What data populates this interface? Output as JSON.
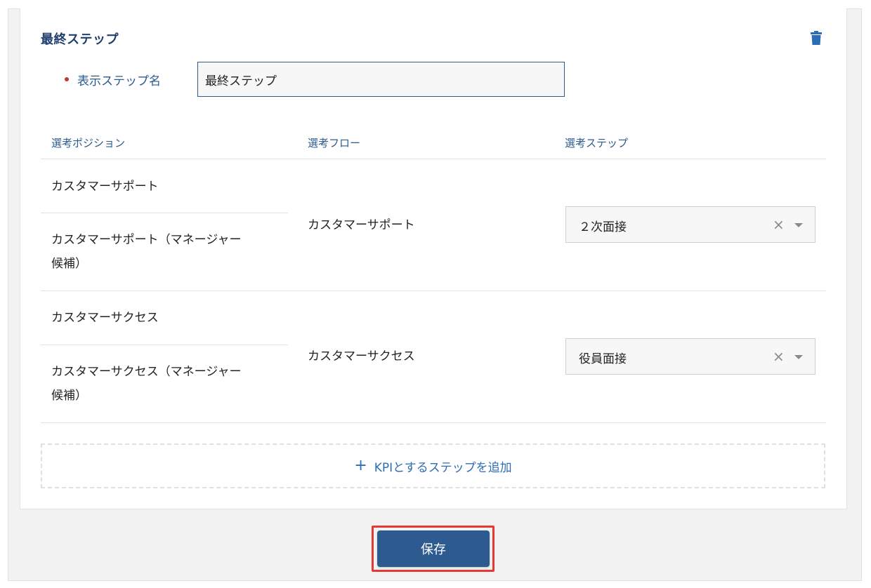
{
  "step": {
    "title": "最終ステップ",
    "field_label": "表示ステップ名",
    "field_value": "最終ステップ"
  },
  "table": {
    "headers": [
      "選考ポジション",
      "選考フロー",
      "選考ステップ"
    ],
    "groups": [
      {
        "positions": [
          "カスタマーサポート",
          "カスタマーサポート（マネージャー",
          "候補）"
        ],
        "flow": "カスタマーサポート",
        "step": "２次面接"
      },
      {
        "positions": [
          "カスタマーサクセス",
          "カスタマーサクセス（マネージャー",
          "候補）"
        ],
        "flow": "カスタマーサクセス",
        "step": "役員面接"
      }
    ]
  },
  "actions": {
    "add_kpi_label": "KPIとするステップを追加",
    "save_label": "保存"
  },
  "icons": {
    "clear": "×",
    "plus": "+"
  },
  "colors": {
    "primary": "#2d5a8f",
    "label": "#2c5a8c",
    "link": "#2d6db5",
    "required": "#c0392b",
    "highlight": "#e53935"
  }
}
